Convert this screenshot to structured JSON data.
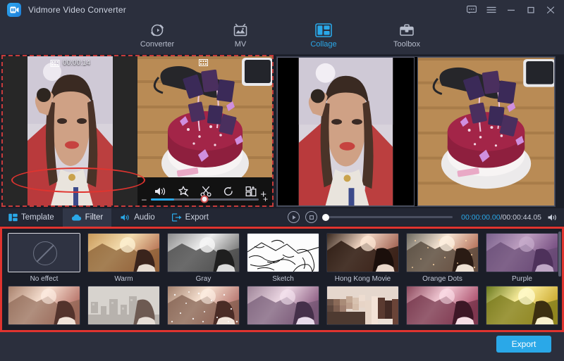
{
  "app": {
    "title": "Vidmore Video Converter",
    "logo_icon": "video-camera-icon",
    "accent_color": "#2aa8e8",
    "annotation_color": "#e0342f",
    "selection_color": "#d8d43a"
  },
  "window_controls": [
    {
      "name": "feedback-icon",
      "glyph": "feedback"
    },
    {
      "name": "menu-icon",
      "glyph": "menu"
    },
    {
      "name": "minimize-icon",
      "glyph": "minimize"
    },
    {
      "name": "maximize-icon",
      "glyph": "maximize"
    },
    {
      "name": "close-icon",
      "glyph": "close"
    }
  ],
  "nav": {
    "active": "Collage",
    "items": [
      {
        "label": "Converter",
        "icon": "converter-icon"
      },
      {
        "label": "MV",
        "icon": "mv-icon"
      },
      {
        "label": "Collage",
        "icon": "collage-icon"
      },
      {
        "label": "Toolbox",
        "icon": "toolbox-icon"
      }
    ]
  },
  "collage": {
    "clips": [
      {
        "name": "clip-girl",
        "duration": "00:00:14",
        "selected": true,
        "badge_icon": "film-icon"
      },
      {
        "name": "clip-cake",
        "duration": "",
        "selected": false,
        "badge_icon": "film-icon"
      }
    ],
    "clip_toolbar": [
      {
        "name": "volume-icon",
        "label": "Volume"
      },
      {
        "name": "magic-wand-icon",
        "label": "Effects"
      },
      {
        "name": "scissors-icon",
        "label": "Trim"
      },
      {
        "name": "rotate-icon",
        "label": "Rotate"
      },
      {
        "name": "crop-icon",
        "label": "Crop"
      }
    ],
    "zoom_slider": {
      "minus": "–",
      "plus": "+",
      "value": 50
    },
    "add_button": "+"
  },
  "edit_tabs": {
    "active": "Filter",
    "items": [
      {
        "label": "Template",
        "icon": "template-icon"
      },
      {
        "label": "Filter",
        "icon": "filter-cloud-icon"
      },
      {
        "label": "Audio",
        "icon": "audio-icon"
      },
      {
        "label": "Export",
        "icon": "export-icon"
      }
    ]
  },
  "player": {
    "play_icon": "play-icon",
    "stop_icon": "stop-icon",
    "volume_icon": "volume-icon",
    "current_time": "00:00:00.00",
    "separator": "/",
    "total_time": "00:00:44.05",
    "seek_position_percent": 0
  },
  "filters": {
    "selected": "No effect",
    "row1": [
      {
        "label": "No effect",
        "style": "none"
      },
      {
        "label": "Warm",
        "style": "warm"
      },
      {
        "label": "Gray",
        "style": "gray"
      },
      {
        "label": "Sketch",
        "style": "sketch"
      },
      {
        "label": "Hong Kong Movie",
        "style": "hongkong"
      },
      {
        "label": "Orange Dots",
        "style": "orangedots"
      },
      {
        "label": "Purple",
        "style": "purple"
      }
    ],
    "row2": [
      {
        "label": "",
        "style": "r2a"
      },
      {
        "label": "",
        "style": "r2b"
      },
      {
        "label": "",
        "style": "r2c"
      },
      {
        "label": "",
        "style": "r2d"
      },
      {
        "label": "",
        "style": "r2e"
      },
      {
        "label": "",
        "style": "r2f"
      },
      {
        "label": "",
        "style": "r2g"
      }
    ]
  },
  "footer": {
    "export_label": "Export"
  }
}
